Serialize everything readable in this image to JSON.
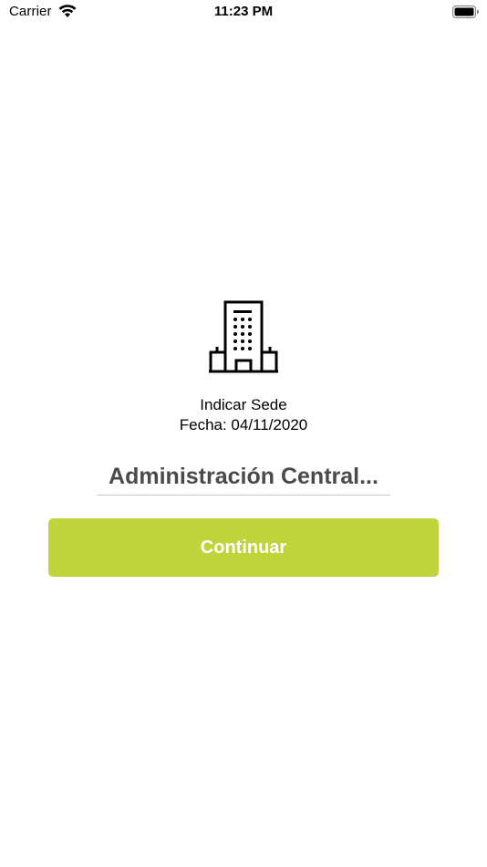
{
  "status_bar": {
    "carrier": "Carrier",
    "time": "11:23 PM",
    "icons": [
      "wifi-icon",
      "battery-icon"
    ]
  },
  "main": {
    "icon": "building-icon",
    "prompt": "Indicar Sede",
    "date_label": "Fecha: 04/11/2020",
    "site_value": "Administración Central...",
    "continue_label": "Continuar"
  },
  "colors": {
    "accent": "#bfd43a",
    "selector_text": "#4a4a4a",
    "background": "#ffffff"
  }
}
